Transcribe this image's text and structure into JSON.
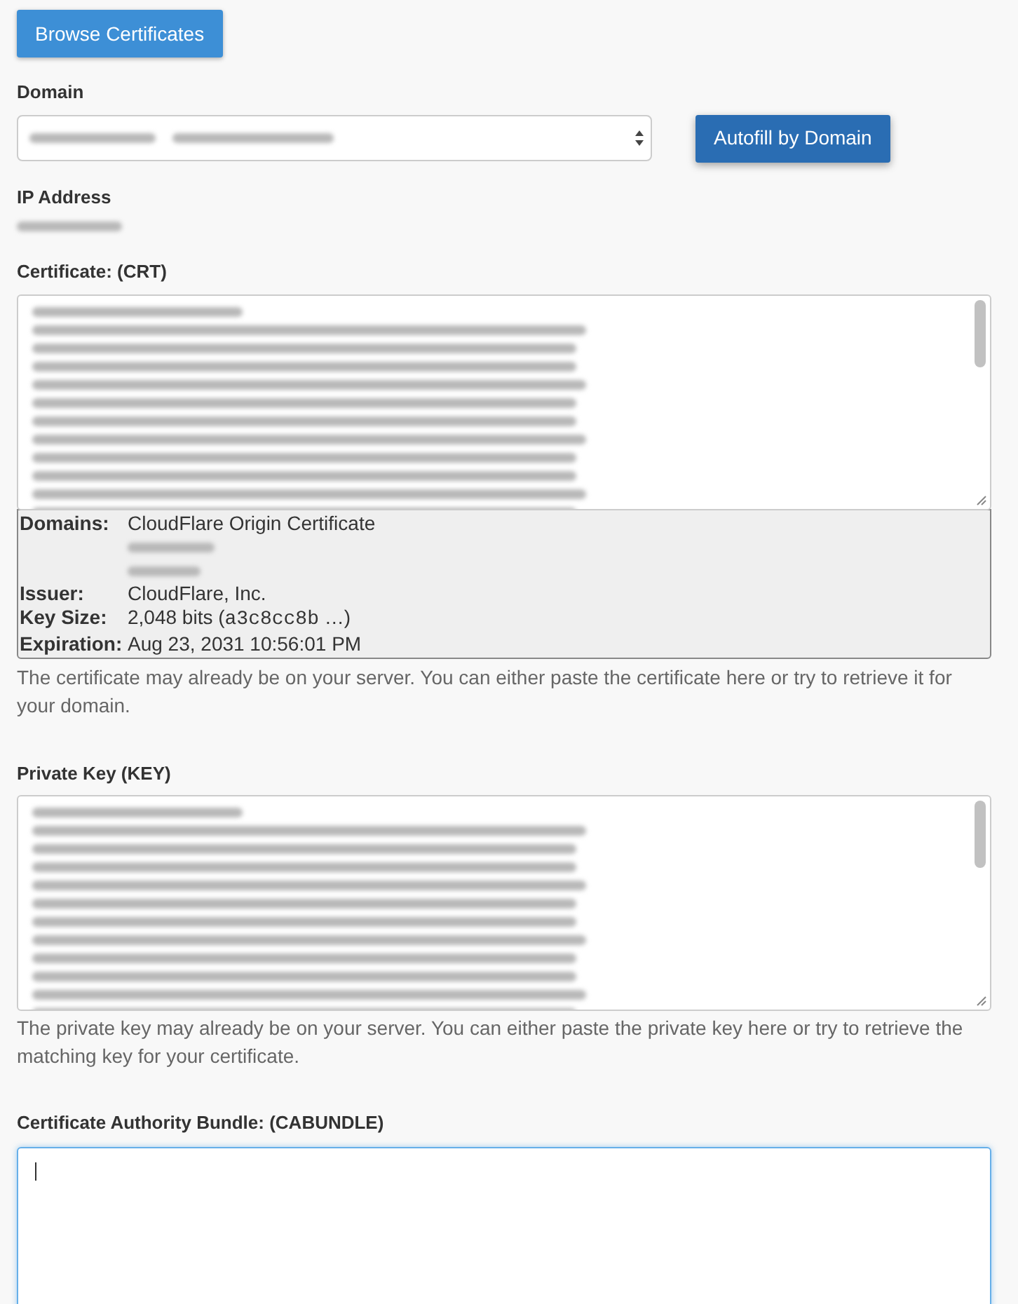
{
  "browse_button": {
    "label": "Browse Certificates"
  },
  "domain": {
    "label": "Domain"
  },
  "autofill_button": {
    "label": "Autofill by Domain"
  },
  "ip_address": {
    "label": "IP Address"
  },
  "certificate": {
    "label": "Certificate: (CRT)",
    "focused": false
  },
  "certificate_details": {
    "rows": [
      {
        "kind": "domains",
        "label": "Domains:",
        "value": "CloudFlare Origin Certificate"
      },
      {
        "kind": "text",
        "label": "Issuer:",
        "value": "CloudFlare, Inc."
      },
      {
        "kind": "key",
        "label": "Key Size:",
        "value": "2,048 bits",
        "open": "(",
        "fingerprint": "a3c8cc8b",
        "suffix": "…)"
      },
      {
        "kind": "text",
        "label": "Expiration:",
        "value": "Aug 23, 2031 10:56:01 PM"
      }
    ]
  },
  "certificate_help": "The certificate may already be on your server. You can either paste the certificate here or try to retrieve it for your domain.",
  "private_key": {
    "label": "Private Key (KEY)",
    "focused": false
  },
  "private_key_help": "The private key may already be on your server. You can either paste the private key here or try to retrieve the matching key for your certificate.",
  "ca_bundle": {
    "label": "Certificate Authority Bundle: (CABUNDLE)",
    "focused": true
  }
}
